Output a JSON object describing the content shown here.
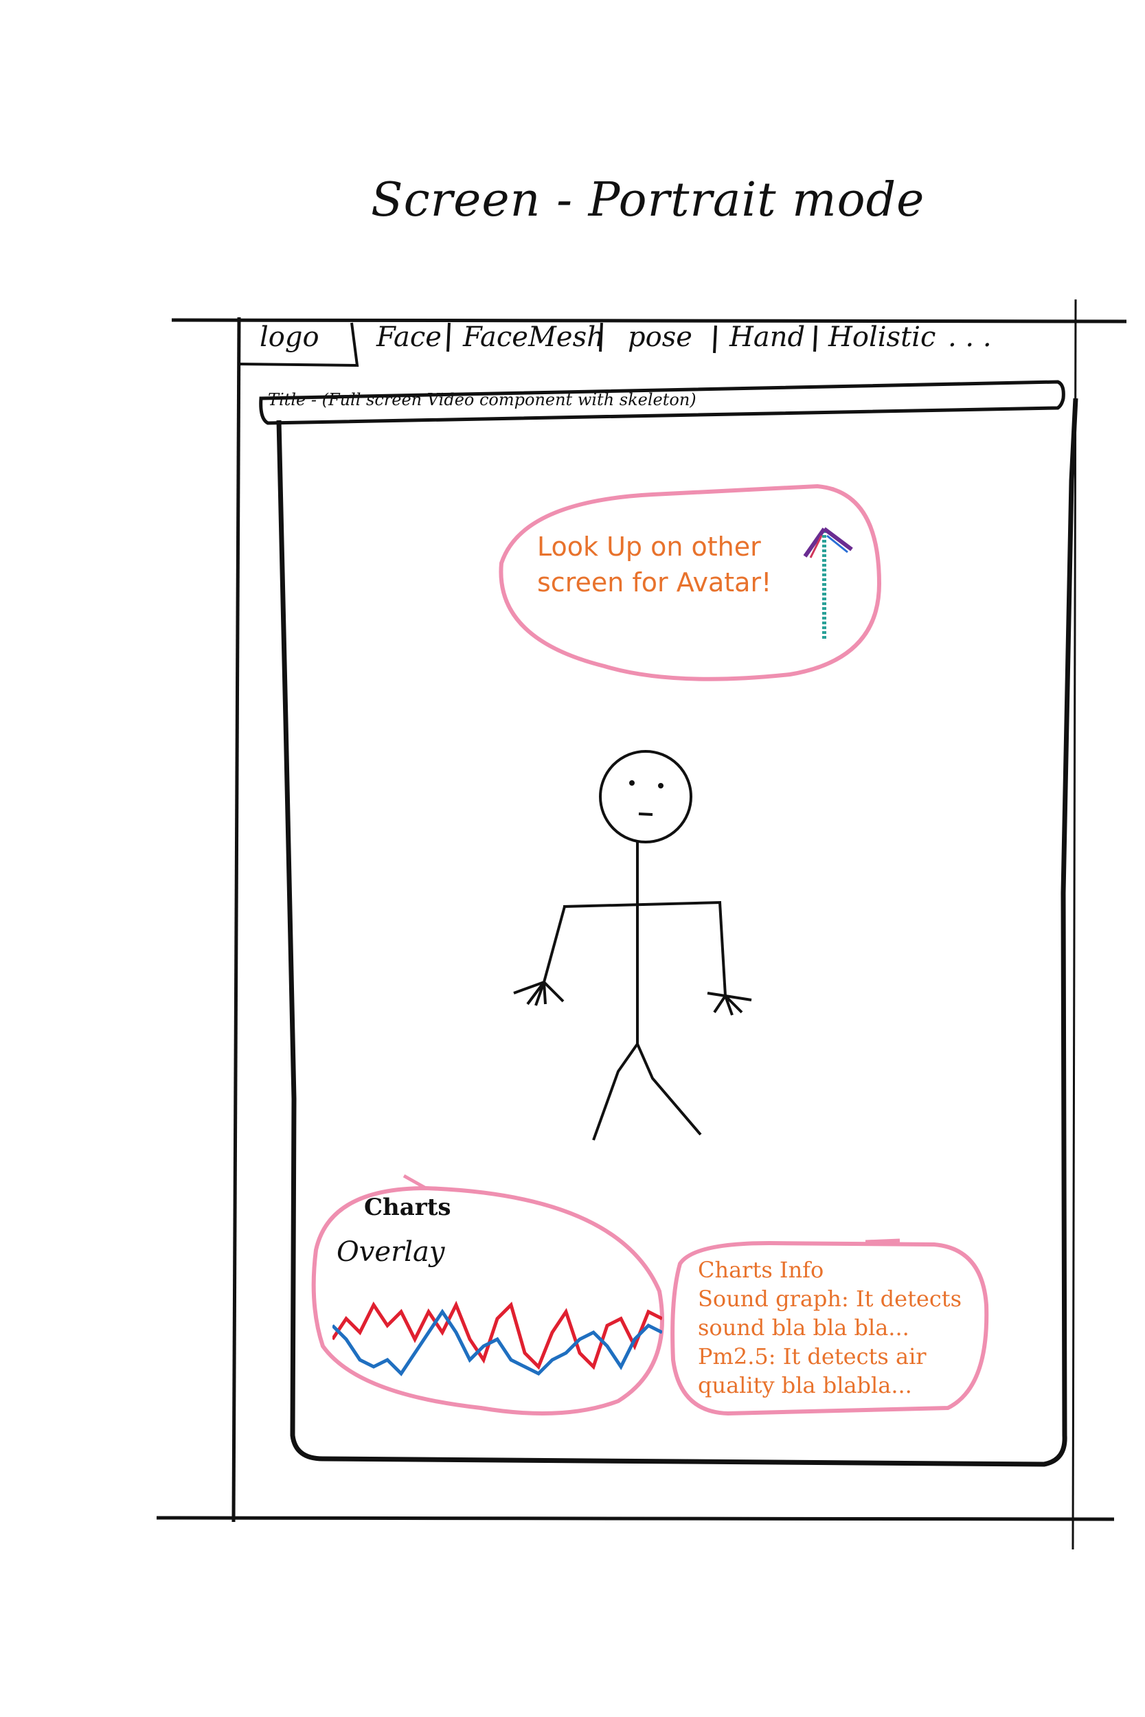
{
  "page": {
    "heading": "Screen - Portrait mode"
  },
  "nav": {
    "logo": "logo",
    "tabs": [
      {
        "label": "Face"
      },
      {
        "label": "FaceMesh"
      },
      {
        "label": "pose"
      },
      {
        "label": "Hand"
      },
      {
        "label": "Holistic"
      }
    ],
    "more": ". . ."
  },
  "video": {
    "title": "Title - (Full screen Video component with skeleton)",
    "callout_line1": "Look Up on other",
    "callout_line2": "screen for Avatar!",
    "arrow_icon": "up-arrow-icon"
  },
  "charts": {
    "title": "Charts",
    "overlay_label": "Overlay",
    "series_colors": {
      "red": "#e02030",
      "blue": "#1f6fc0"
    }
  },
  "charts_info": {
    "line1": "Charts Info",
    "line2": "Sound graph: It detects",
    "line3": "sound bla bla bla...",
    "line4": "Pm2.5: It detects air",
    "line5": "quality bla blabla..."
  },
  "colors": {
    "pink": "#ef8fb0",
    "orange": "#e8722c",
    "ink": "#111111"
  }
}
